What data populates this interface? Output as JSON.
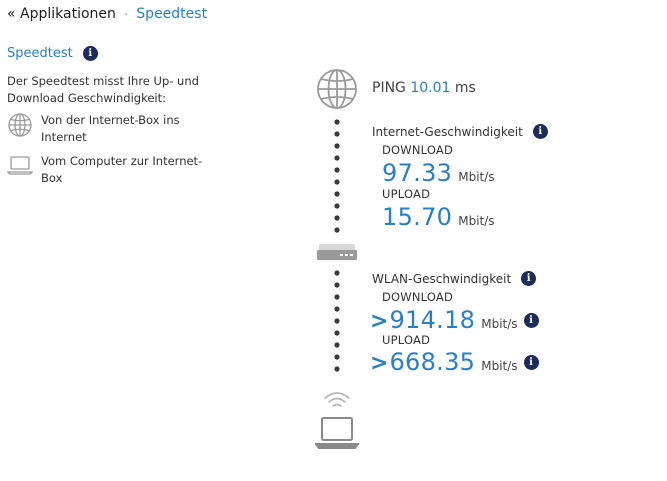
{
  "breadcrumb": {
    "back": "« Applikationen",
    "separator": "·",
    "current": "Speedtest"
  },
  "sidebar": {
    "title": "Speedtest",
    "description": "Der Speedtest misst Ihre Up- und Download Geschwindigkeit:",
    "legend": [
      {
        "icon": "globe-icon",
        "label": "Von der Internet-Box ins Internet"
      },
      {
        "icon": "laptop-icon",
        "label": "Vom Computer zur Internet-Box"
      }
    ]
  },
  "ping": {
    "label": "PING",
    "value": "10.01",
    "unit": "ms"
  },
  "internet": {
    "title": "Internet-Geschwindigkeit",
    "download_label": "DOWNLOAD",
    "download_value": "97.33",
    "download_unit": "Mbit/s",
    "upload_label": "UPLOAD",
    "upload_value": "15.70",
    "upload_unit": "Mbit/s"
  },
  "wlan": {
    "title": "WLAN-Geschwindigkeit",
    "download_label": "DOWNLOAD",
    "download_prefix": ">",
    "download_value": "914.18",
    "download_unit": "Mbit/s",
    "upload_label": "UPLOAD",
    "upload_prefix": ">",
    "upload_value": "668.35",
    "upload_unit": "Mbit/s"
  },
  "info_glyph": "i",
  "colors": {
    "accent": "#2a7fc4",
    "info_badge": "#1c2b57",
    "icon_gray": "#9a9a9a",
    "dots": "#3a3a3a"
  }
}
